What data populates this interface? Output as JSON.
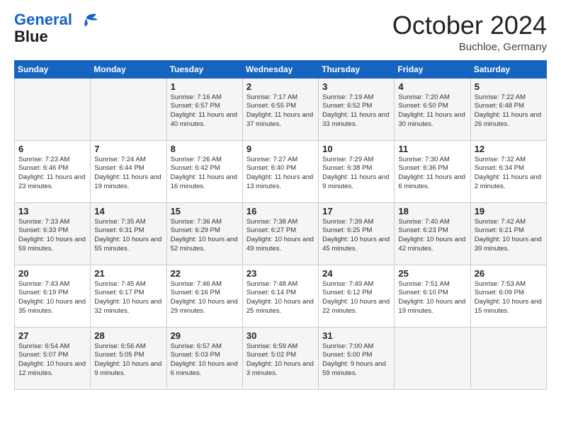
{
  "header": {
    "logo_line1": "General",
    "logo_line2": "Blue",
    "month": "October 2024",
    "location": "Buchloe, Germany"
  },
  "days_of_week": [
    "Sunday",
    "Monday",
    "Tuesday",
    "Wednesday",
    "Thursday",
    "Friday",
    "Saturday"
  ],
  "weeks": [
    [
      {
        "day": "",
        "sunrise": "",
        "sunset": "",
        "daylight": ""
      },
      {
        "day": "",
        "sunrise": "",
        "sunset": "",
        "daylight": ""
      },
      {
        "day": "1",
        "sunrise": "Sunrise: 7:16 AM",
        "sunset": "Sunset: 6:57 PM",
        "daylight": "Daylight: 11 hours and 40 minutes."
      },
      {
        "day": "2",
        "sunrise": "Sunrise: 7:17 AM",
        "sunset": "Sunset: 6:55 PM",
        "daylight": "Daylight: 11 hours and 37 minutes."
      },
      {
        "day": "3",
        "sunrise": "Sunrise: 7:19 AM",
        "sunset": "Sunset: 6:52 PM",
        "daylight": "Daylight: 11 hours and 33 minutes."
      },
      {
        "day": "4",
        "sunrise": "Sunrise: 7:20 AM",
        "sunset": "Sunset: 6:50 PM",
        "daylight": "Daylight: 11 hours and 30 minutes."
      },
      {
        "day": "5",
        "sunrise": "Sunrise: 7:22 AM",
        "sunset": "Sunset: 6:48 PM",
        "daylight": "Daylight: 11 hours and 26 minutes."
      }
    ],
    [
      {
        "day": "6",
        "sunrise": "Sunrise: 7:23 AM",
        "sunset": "Sunset: 6:46 PM",
        "daylight": "Daylight: 11 hours and 23 minutes."
      },
      {
        "day": "7",
        "sunrise": "Sunrise: 7:24 AM",
        "sunset": "Sunset: 6:44 PM",
        "daylight": "Daylight: 11 hours and 19 minutes."
      },
      {
        "day": "8",
        "sunrise": "Sunrise: 7:26 AM",
        "sunset": "Sunset: 6:42 PM",
        "daylight": "Daylight: 11 hours and 16 minutes."
      },
      {
        "day": "9",
        "sunrise": "Sunrise: 7:27 AM",
        "sunset": "Sunset: 6:40 PM",
        "daylight": "Daylight: 11 hours and 13 minutes."
      },
      {
        "day": "10",
        "sunrise": "Sunrise: 7:29 AM",
        "sunset": "Sunset: 6:38 PM",
        "daylight": "Daylight: 11 hours and 9 minutes."
      },
      {
        "day": "11",
        "sunrise": "Sunrise: 7:30 AM",
        "sunset": "Sunset: 6:36 PM",
        "daylight": "Daylight: 11 hours and 6 minutes."
      },
      {
        "day": "12",
        "sunrise": "Sunrise: 7:32 AM",
        "sunset": "Sunset: 6:34 PM",
        "daylight": "Daylight: 11 hours and 2 minutes."
      }
    ],
    [
      {
        "day": "13",
        "sunrise": "Sunrise: 7:33 AM",
        "sunset": "Sunset: 6:33 PM",
        "daylight": "Daylight: 10 hours and 59 minutes."
      },
      {
        "day": "14",
        "sunrise": "Sunrise: 7:35 AM",
        "sunset": "Sunset: 6:31 PM",
        "daylight": "Daylight: 10 hours and 55 minutes."
      },
      {
        "day": "15",
        "sunrise": "Sunrise: 7:36 AM",
        "sunset": "Sunset: 6:29 PM",
        "daylight": "Daylight: 10 hours and 52 minutes."
      },
      {
        "day": "16",
        "sunrise": "Sunrise: 7:38 AM",
        "sunset": "Sunset: 6:27 PM",
        "daylight": "Daylight: 10 hours and 49 minutes."
      },
      {
        "day": "17",
        "sunrise": "Sunrise: 7:39 AM",
        "sunset": "Sunset: 6:25 PM",
        "daylight": "Daylight: 10 hours and 45 minutes."
      },
      {
        "day": "18",
        "sunrise": "Sunrise: 7:40 AM",
        "sunset": "Sunset: 6:23 PM",
        "daylight": "Daylight: 10 hours and 42 minutes."
      },
      {
        "day": "19",
        "sunrise": "Sunrise: 7:42 AM",
        "sunset": "Sunset: 6:21 PM",
        "daylight": "Daylight: 10 hours and 39 minutes."
      }
    ],
    [
      {
        "day": "20",
        "sunrise": "Sunrise: 7:43 AM",
        "sunset": "Sunset: 6:19 PM",
        "daylight": "Daylight: 10 hours and 35 minutes."
      },
      {
        "day": "21",
        "sunrise": "Sunrise: 7:45 AM",
        "sunset": "Sunset: 6:17 PM",
        "daylight": "Daylight: 10 hours and 32 minutes."
      },
      {
        "day": "22",
        "sunrise": "Sunrise: 7:46 AM",
        "sunset": "Sunset: 6:16 PM",
        "daylight": "Daylight: 10 hours and 29 minutes."
      },
      {
        "day": "23",
        "sunrise": "Sunrise: 7:48 AM",
        "sunset": "Sunset: 6:14 PM",
        "daylight": "Daylight: 10 hours and 25 minutes."
      },
      {
        "day": "24",
        "sunrise": "Sunrise: 7:49 AM",
        "sunset": "Sunset: 6:12 PM",
        "daylight": "Daylight: 10 hours and 22 minutes."
      },
      {
        "day": "25",
        "sunrise": "Sunrise: 7:51 AM",
        "sunset": "Sunset: 6:10 PM",
        "daylight": "Daylight: 10 hours and 19 minutes."
      },
      {
        "day": "26",
        "sunrise": "Sunrise: 7:53 AM",
        "sunset": "Sunset: 6:09 PM",
        "daylight": "Daylight: 10 hours and 15 minutes."
      }
    ],
    [
      {
        "day": "27",
        "sunrise": "Sunrise: 6:54 AM",
        "sunset": "Sunset: 5:07 PM",
        "daylight": "Daylight: 10 hours and 12 minutes."
      },
      {
        "day": "28",
        "sunrise": "Sunrise: 6:56 AM",
        "sunset": "Sunset: 5:05 PM",
        "daylight": "Daylight: 10 hours and 9 minutes."
      },
      {
        "day": "29",
        "sunrise": "Sunrise: 6:57 AM",
        "sunset": "Sunset: 5:03 PM",
        "daylight": "Daylight: 10 hours and 6 minutes."
      },
      {
        "day": "30",
        "sunrise": "Sunrise: 6:59 AM",
        "sunset": "Sunset: 5:02 PM",
        "daylight": "Daylight: 10 hours and 3 minutes."
      },
      {
        "day": "31",
        "sunrise": "Sunrise: 7:00 AM",
        "sunset": "Sunset: 5:00 PM",
        "daylight": "Daylight: 9 hours and 59 minutes."
      },
      {
        "day": "",
        "sunrise": "",
        "sunset": "",
        "daylight": ""
      },
      {
        "day": "",
        "sunrise": "",
        "sunset": "",
        "daylight": ""
      }
    ]
  ]
}
